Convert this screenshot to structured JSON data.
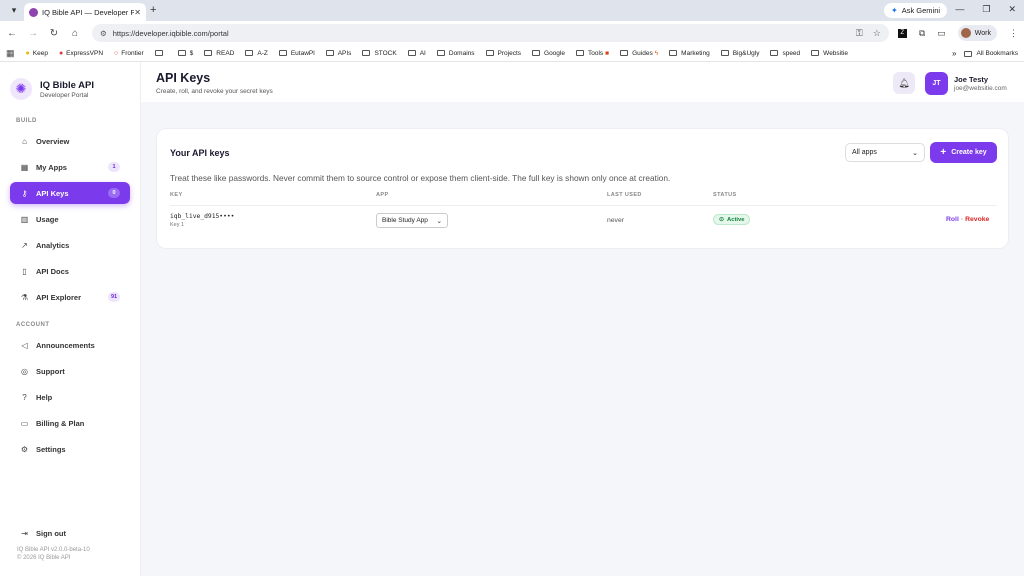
{
  "browser": {
    "tab_title": "IQ Bible API — Developer Portal",
    "new_tab": "+",
    "gemini_label": "Ask Gemini",
    "url": "https://developer.iqbible.com/portal",
    "profile_label": "Work",
    "bookmarks": [
      "Keep",
      "ExpressVPN",
      "Frontier",
      "",
      "$",
      "READ",
      "A-Z",
      "EutawPl",
      "APIs",
      "STOCK",
      "AI",
      "Domains",
      "Projects",
      "Google",
      "Tools",
      "Guides",
      "Marketing",
      "Big&Ugly",
      "speed",
      "Websitie"
    ],
    "all_bookmarks": "All Bookmarks"
  },
  "sidebar": {
    "brand_name": "IQ Bible API",
    "brand_sub": "Developer Portal",
    "section_build": "BUILD",
    "section_account": "ACCOUNT",
    "build_items": [
      {
        "label": "Overview",
        "badge": ""
      },
      {
        "label": "My Apps",
        "badge": "1"
      },
      {
        "label": "API Keys",
        "badge": "0"
      },
      {
        "label": "Usage",
        "badge": ""
      },
      {
        "label": "Analytics",
        "badge": ""
      },
      {
        "label": "API Docs",
        "badge": ""
      },
      {
        "label": "API Explorer",
        "badge": "91"
      }
    ],
    "account_items": [
      {
        "label": "Announcements"
      },
      {
        "label": "Support"
      },
      {
        "label": "Help"
      },
      {
        "label": "Billing & Plan"
      },
      {
        "label": "Settings"
      }
    ],
    "sign_out": "Sign out",
    "version": "IQ Bible API v2.0.0-beta-10",
    "copyright": "© 2026 IQ Bible API"
  },
  "header": {
    "title": "API Keys",
    "subtitle": "Create, roll, and revoke your secret keys",
    "user_initials": "JT",
    "user_name": "Joe Testy",
    "user_email": "joe@websitie.com"
  },
  "card": {
    "title": "Your API keys",
    "filter_value": "All apps",
    "create_label": "Create key",
    "warning": "Treat these like passwords. Never commit them to source control or expose them client-side. The full key is shown only once at creation.",
    "columns": [
      "KEY",
      "APP",
      "LAST USED",
      "STATUS"
    ],
    "rows": [
      {
        "key": "iqb_live_d915••••",
        "label": "Key 1",
        "app": "Bible Study App",
        "last_used": "never",
        "status": "Active",
        "roll": "Roll",
        "separator": "·",
        "revoke": "Revoke"
      }
    ]
  },
  "colors": {
    "accent": "#7c3aed",
    "danger": "#dc2626",
    "success": "#15803d"
  }
}
